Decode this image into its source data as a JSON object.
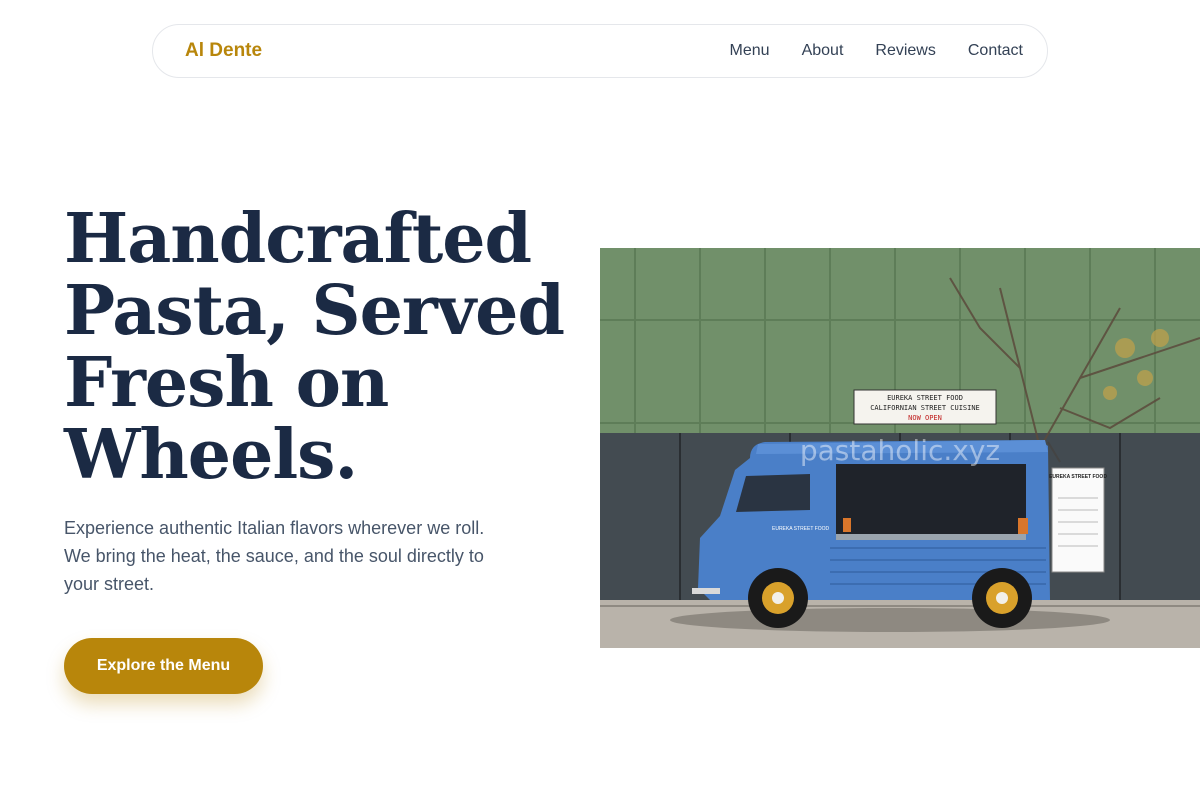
{
  "brand": {
    "name": "Al Dente"
  },
  "nav": {
    "items": [
      "Menu",
      "About",
      "Reviews",
      "Contact"
    ]
  },
  "hero": {
    "headline": "Handcrafted Pasta, Served Fresh on Wheels.",
    "subtitle": "Experience authentic Italian flavors wherever we roll. We bring the heat, the sauce, and the soul directly to your street.",
    "cta_label": "Explore the Menu"
  },
  "image": {
    "sign_line1": "EUREKA STREET FOOD",
    "sign_line2": "CALIFORNIAN STREET CUISINE",
    "sign_line3": "NOW OPEN",
    "board_title": "EUREKA STREET FOOD",
    "truck_label": "EUREKA STREET FOOD",
    "watermark": "pastaholic.xyz"
  },
  "colors": {
    "accent": "#b8860b",
    "headline": "#1b2a44",
    "body_text": "#475569",
    "truck": "#4a7fc8"
  }
}
